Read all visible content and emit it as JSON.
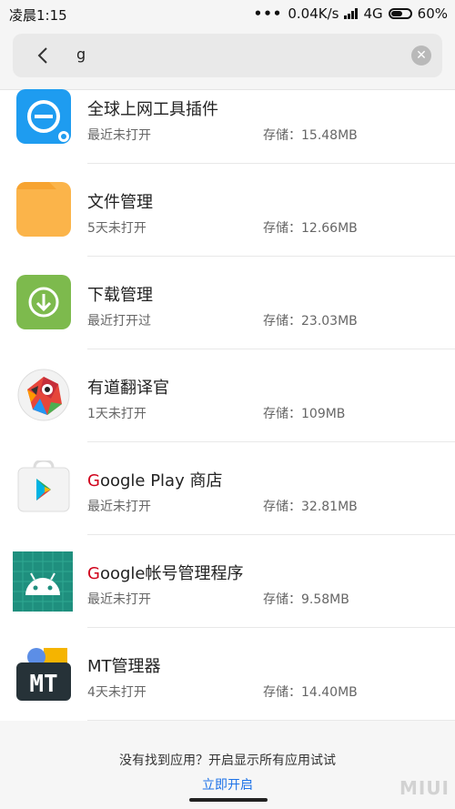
{
  "status_bar": {
    "time": "凌晨1:15",
    "dots": "•••",
    "net_speed": "0.04K/s",
    "network": "4G",
    "battery": "60%",
    "battery_level": 0.6
  },
  "search": {
    "query": "g"
  },
  "apps": [
    {
      "name": "全球上网工具插件",
      "name_highlight": "",
      "status": "最近未打开",
      "size": "存储：15.48MB",
      "icon": "globe-plane-icon"
    },
    {
      "name": "文件管理",
      "name_highlight": "",
      "status": "5天未打开",
      "size": "存储：12.66MB",
      "icon": "folder-icon"
    },
    {
      "name": "下载管理",
      "name_highlight": "",
      "status": "最近打开过",
      "size": "存储：23.03MB",
      "icon": "download-icon"
    },
    {
      "name": "有道翻译官",
      "name_highlight": "",
      "status": "1天未打开",
      "size": "存储：109MB",
      "icon": "parrot-icon"
    },
    {
      "name": "oogle Play 商店",
      "name_highlight": "G",
      "status": "最近未打开",
      "size": "存储：32.81MB",
      "icon": "google-play-icon"
    },
    {
      "name": "oogle帐号管理程序",
      "name_highlight": "G",
      "status": "最近未打开",
      "size": "存储：9.58MB",
      "icon": "android-icon"
    },
    {
      "name": "MT管理器",
      "name_highlight": "",
      "status": "4天未打开",
      "size": "存储：14.40MB",
      "icon": "mt-icon"
    }
  ],
  "bottom": {
    "message": "没有找到应用？开启显示所有应用试试",
    "link": "立即开启",
    "watermark": "MIUI"
  },
  "colors": {
    "link": "#1e73e8",
    "highlight": "#d0021b",
    "folder": "#fbb44a",
    "download": "#7dba4d",
    "globe": "#1e9cf0",
    "android_bg": "#1f8f7e"
  }
}
